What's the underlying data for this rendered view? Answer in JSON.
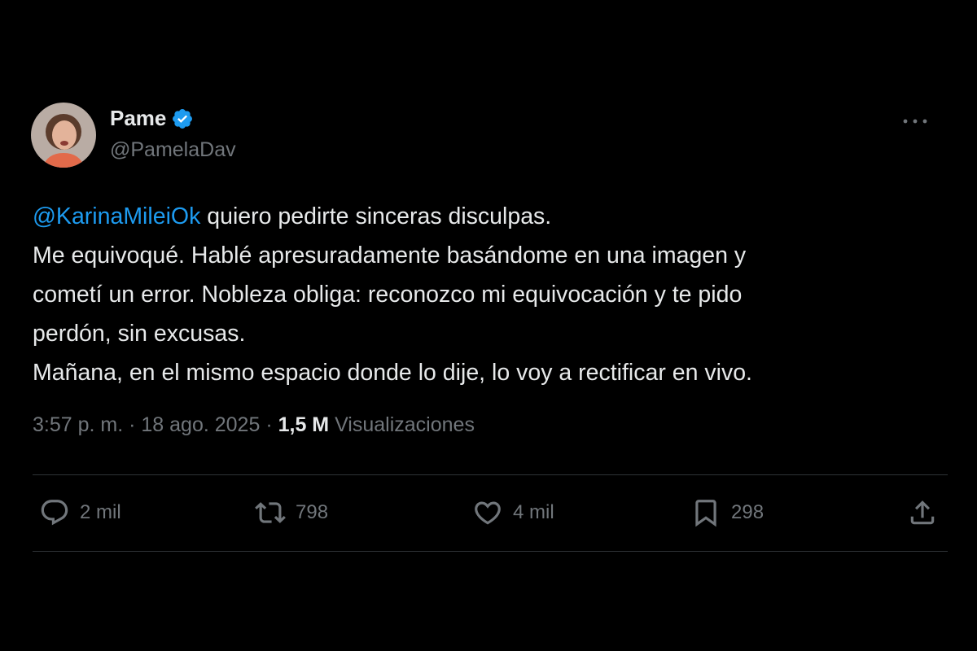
{
  "tweet": {
    "author": {
      "display_name": "Pame",
      "handle": "@PamelaDav",
      "verified_badge_icon": "verified-badge-icon",
      "verified_color": "#1d9bf0"
    },
    "more_icon": "more-horizontal-icon",
    "text": {
      "mention": "@KarinaMileiOk",
      "line1_rest": " quiero pedirte sinceras disculpas.",
      "line2": "Me equivoqué. Hablé apresuradamente basándome en una imagen y",
      "line3": "cometí un error. Nobleza obliga: reconozco mi equivocación y te pido",
      "line4": "perdón, sin excusas.",
      "line5": "Mañana, en el mismo espacio donde lo dije, lo voy a rectificar en vivo."
    },
    "meta": {
      "time": "3:57 p. m.",
      "separator": " · ",
      "date": "18 ago. 2025",
      "views_count": "1,5 M",
      "views_label": "Visualizaciones"
    },
    "actions": {
      "reply": {
        "icon": "reply-icon",
        "count": "2 mil"
      },
      "retweet": {
        "icon": "retweet-icon",
        "count": "798"
      },
      "like": {
        "icon": "heart-icon",
        "count": "4 mil"
      },
      "bookmark": {
        "icon": "bookmark-icon",
        "count": "298"
      },
      "share": {
        "icon": "share-icon"
      }
    },
    "colors": {
      "background": "#000000",
      "text": "#e7e9ea",
      "secondary": "#71767b",
      "accent": "#1d9bf0",
      "divider": "#2f3336"
    }
  }
}
